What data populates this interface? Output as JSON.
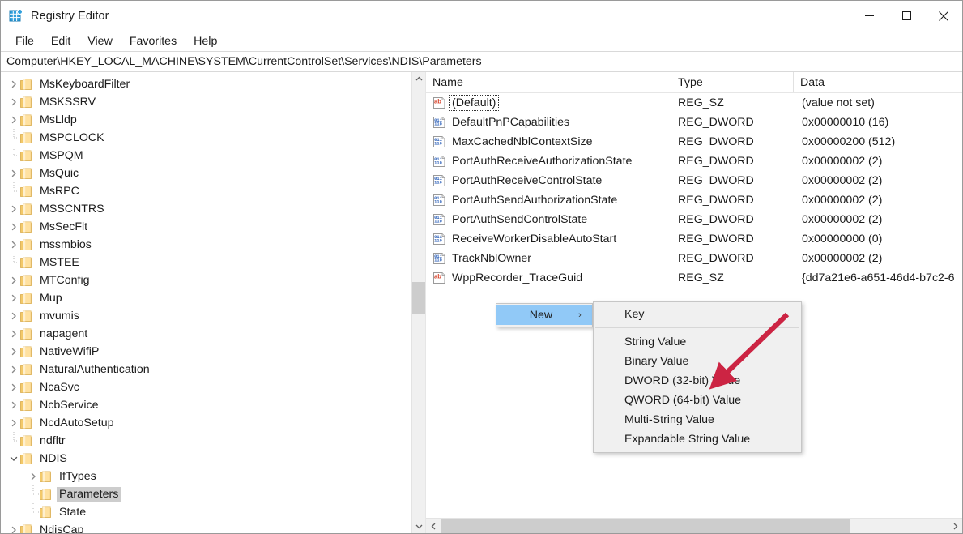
{
  "window": {
    "title": "Registry Editor",
    "app_icon": "registry-editor-icon",
    "minimize_glyph": "–",
    "maximize_glyph": "☐",
    "close_glyph": "✕"
  },
  "menubar": {
    "items": [
      {
        "label": "File"
      },
      {
        "label": "Edit"
      },
      {
        "label": "View"
      },
      {
        "label": "Favorites"
      },
      {
        "label": "Help"
      }
    ]
  },
  "address": {
    "path": "Computer\\HKEY_LOCAL_MACHINE\\SYSTEM\\CurrentControlSet\\Services\\NDIS\\Parameters"
  },
  "tree": {
    "items": [
      {
        "label": "MsKeyboardFilter",
        "indent": 0,
        "state": "collapsed",
        "selected": false
      },
      {
        "label": "MSKSSRV",
        "indent": 0,
        "state": "collapsed",
        "selected": false
      },
      {
        "label": "MsLldp",
        "indent": 0,
        "state": "collapsed",
        "selected": false
      },
      {
        "label": "MSPCLOCK",
        "indent": 0,
        "state": "leaf",
        "selected": false
      },
      {
        "label": "MSPQM",
        "indent": 0,
        "state": "leaf",
        "selected": false
      },
      {
        "label": "MsQuic",
        "indent": 0,
        "state": "collapsed",
        "selected": false
      },
      {
        "label": "MsRPC",
        "indent": 0,
        "state": "leaf",
        "selected": false
      },
      {
        "label": "MSSCNTRS",
        "indent": 0,
        "state": "collapsed",
        "selected": false
      },
      {
        "label": "MsSecFlt",
        "indent": 0,
        "state": "collapsed",
        "selected": false
      },
      {
        "label": "mssmbios",
        "indent": 0,
        "state": "collapsed",
        "selected": false
      },
      {
        "label": "MSTEE",
        "indent": 0,
        "state": "leaf",
        "selected": false
      },
      {
        "label": "MTConfig",
        "indent": 0,
        "state": "collapsed",
        "selected": false
      },
      {
        "label": "Mup",
        "indent": 0,
        "state": "collapsed",
        "selected": false
      },
      {
        "label": "mvumis",
        "indent": 0,
        "state": "collapsed",
        "selected": false
      },
      {
        "label": "napagent",
        "indent": 0,
        "state": "collapsed",
        "selected": false
      },
      {
        "label": "NativeWifiP",
        "indent": 0,
        "state": "collapsed",
        "selected": false
      },
      {
        "label": "NaturalAuthentication",
        "indent": 0,
        "state": "collapsed",
        "selected": false
      },
      {
        "label": "NcaSvc",
        "indent": 0,
        "state": "collapsed",
        "selected": false
      },
      {
        "label": "NcbService",
        "indent": 0,
        "state": "collapsed",
        "selected": false
      },
      {
        "label": "NcdAutoSetup",
        "indent": 0,
        "state": "collapsed",
        "selected": false
      },
      {
        "label": "ndfltr",
        "indent": 0,
        "state": "leaf",
        "selected": false
      },
      {
        "label": "NDIS",
        "indent": 0,
        "state": "expanded",
        "selected": false
      },
      {
        "label": "IfTypes",
        "indent": 1,
        "state": "collapsed",
        "selected": false
      },
      {
        "label": "Parameters",
        "indent": 1,
        "state": "leaf",
        "selected": true
      },
      {
        "label": "State",
        "indent": 1,
        "state": "leaf",
        "selected": false
      },
      {
        "label": "NdisCap",
        "indent": 0,
        "state": "collapsed",
        "selected": false
      }
    ]
  },
  "list": {
    "columns": [
      {
        "label": "Name"
      },
      {
        "label": "Type"
      },
      {
        "label": "Data"
      }
    ],
    "rows": [
      {
        "icon": "string-value-icon",
        "name": "(Default)",
        "type": "REG_SZ",
        "data": "(value not set)",
        "focused": true
      },
      {
        "icon": "dword-value-icon",
        "name": "DefaultPnPCapabilities",
        "type": "REG_DWORD",
        "data": "0x00000010 (16)",
        "focused": false
      },
      {
        "icon": "dword-value-icon",
        "name": "MaxCachedNblContextSize",
        "type": "REG_DWORD",
        "data": "0x00000200 (512)",
        "focused": false
      },
      {
        "icon": "dword-value-icon",
        "name": "PortAuthReceiveAuthorizationState",
        "type": "REG_DWORD",
        "data": "0x00000002 (2)",
        "focused": false
      },
      {
        "icon": "dword-value-icon",
        "name": "PortAuthReceiveControlState",
        "type": "REG_DWORD",
        "data": "0x00000002 (2)",
        "focused": false
      },
      {
        "icon": "dword-value-icon",
        "name": "PortAuthSendAuthorizationState",
        "type": "REG_DWORD",
        "data": "0x00000002 (2)",
        "focused": false
      },
      {
        "icon": "dword-value-icon",
        "name": "PortAuthSendControlState",
        "type": "REG_DWORD",
        "data": "0x00000002 (2)",
        "focused": false
      },
      {
        "icon": "dword-value-icon",
        "name": "ReceiveWorkerDisableAutoStart",
        "type": "REG_DWORD",
        "data": "0x00000000 (0)",
        "focused": false
      },
      {
        "icon": "dword-value-icon",
        "name": "TrackNblOwner",
        "type": "REG_DWORD",
        "data": "0x00000002 (2)",
        "focused": false
      },
      {
        "icon": "string-value-icon",
        "name": "WppRecorder_TraceGuid",
        "type": "REG_SZ",
        "data": "{dd7a21e6-a651-46d4-b7c2-6",
        "focused": false
      }
    ]
  },
  "context_menu": {
    "parent": {
      "label": "New",
      "submenu_arrow": "›",
      "highlighted": true
    },
    "submenu": [
      {
        "label": "Key",
        "separator_after": true
      },
      {
        "label": "String Value",
        "separator_after": false
      },
      {
        "label": "Binary Value",
        "separator_after": false
      },
      {
        "label": "DWORD (32-bit) Value",
        "separator_after": false
      },
      {
        "label": "QWORD (64-bit) Value",
        "separator_after": false
      },
      {
        "label": "Multi-String Value",
        "separator_after": false
      },
      {
        "label": "Expandable String Value",
        "separator_after": false
      }
    ]
  },
  "annotation": {
    "arrow": "red-arrow-pointer",
    "color": "#cc2443"
  },
  "scrollbars": {
    "tree_vertical": {
      "up_glyph": "⌃",
      "down_glyph": "⌄"
    },
    "list_horizontal": {
      "left_glyph": "‹",
      "right_glyph": "›"
    }
  },
  "colors": {
    "selection": "#cdcdcd",
    "menu_highlight": "#91c9f7",
    "folder": "#ffd277",
    "reg_sz_icon": "#d8422a",
    "reg_dword_icon": "#2b5fb8"
  }
}
